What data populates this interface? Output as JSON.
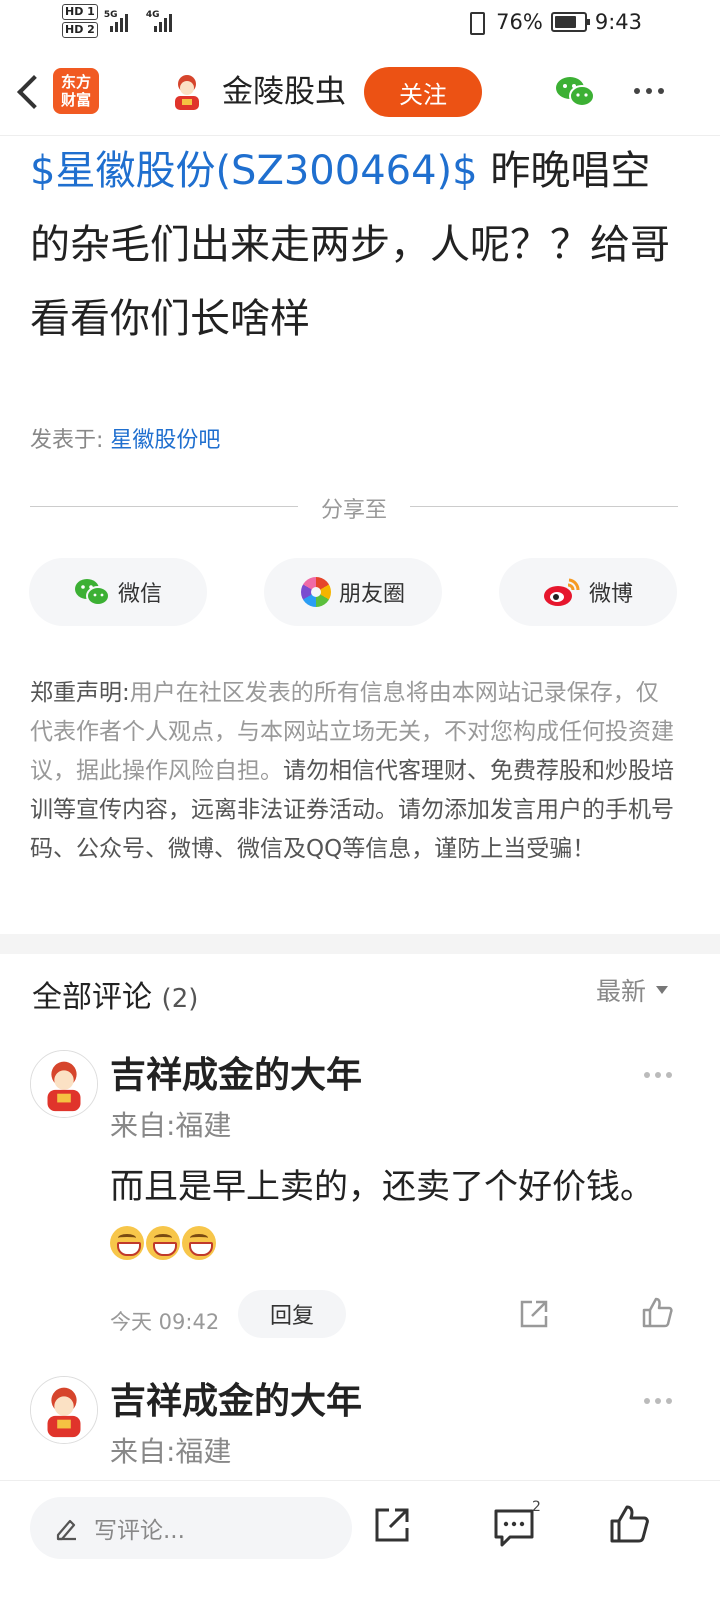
{
  "status_bar": {
    "hd1": "HD 1",
    "hd2": "HD 2",
    "net1": "5G",
    "net2": "4G",
    "battery_percent": "76%",
    "battery_level": 0.76,
    "time": "9:43"
  },
  "header": {
    "logo_line1": "东方",
    "logo_line2": "财富",
    "author_name": "金陵股虫",
    "follow_label": "关注"
  },
  "post": {
    "stock_link": "$星徽股份(SZ300464)$",
    "body": " 昨晚唱空的杂毛们出来走两步，人呢？？给哥看看你们长啥样",
    "posted_in_label": "发表于:",
    "posted_in_bar": "星徽股份吧"
  },
  "share": {
    "label": "分享至",
    "wechat": "微信",
    "moments": "朋友圈",
    "weibo": "微博"
  },
  "disclaimer": {
    "title": "郑重声明:",
    "text": "用户在社区发表的所有信息将由本网站记录保存，仅代表作者个人观点，与本网站立场无关，不对您构成任何投资建议，据此操作风险自担。",
    "warning": "请勿相信代客理财、免费荐股和炒股培训等宣传内容，远离非法证券活动。请勿添加发言用户的手机号码、公众号、微博、微信及QQ等信息，谨防上当受骗！"
  },
  "comments": {
    "title": "全部评论",
    "count": "(2)",
    "sort_label": "最新",
    "items": [
      {
        "name": "吉祥成金的大年",
        "location": "来自:福建",
        "text": "而且是早上卖的，还卖了个好价钱。",
        "time": "今天 09:42",
        "reply_label": "回复"
      },
      {
        "name": "吉祥成金的大年",
        "location": "来自:福建"
      }
    ]
  },
  "bottom_bar": {
    "input_placeholder": "写评论...",
    "comment_count": "2"
  },
  "colors": {
    "accent": "#ec5214",
    "link": "#1f6fcf",
    "logo": "#f15a22"
  }
}
